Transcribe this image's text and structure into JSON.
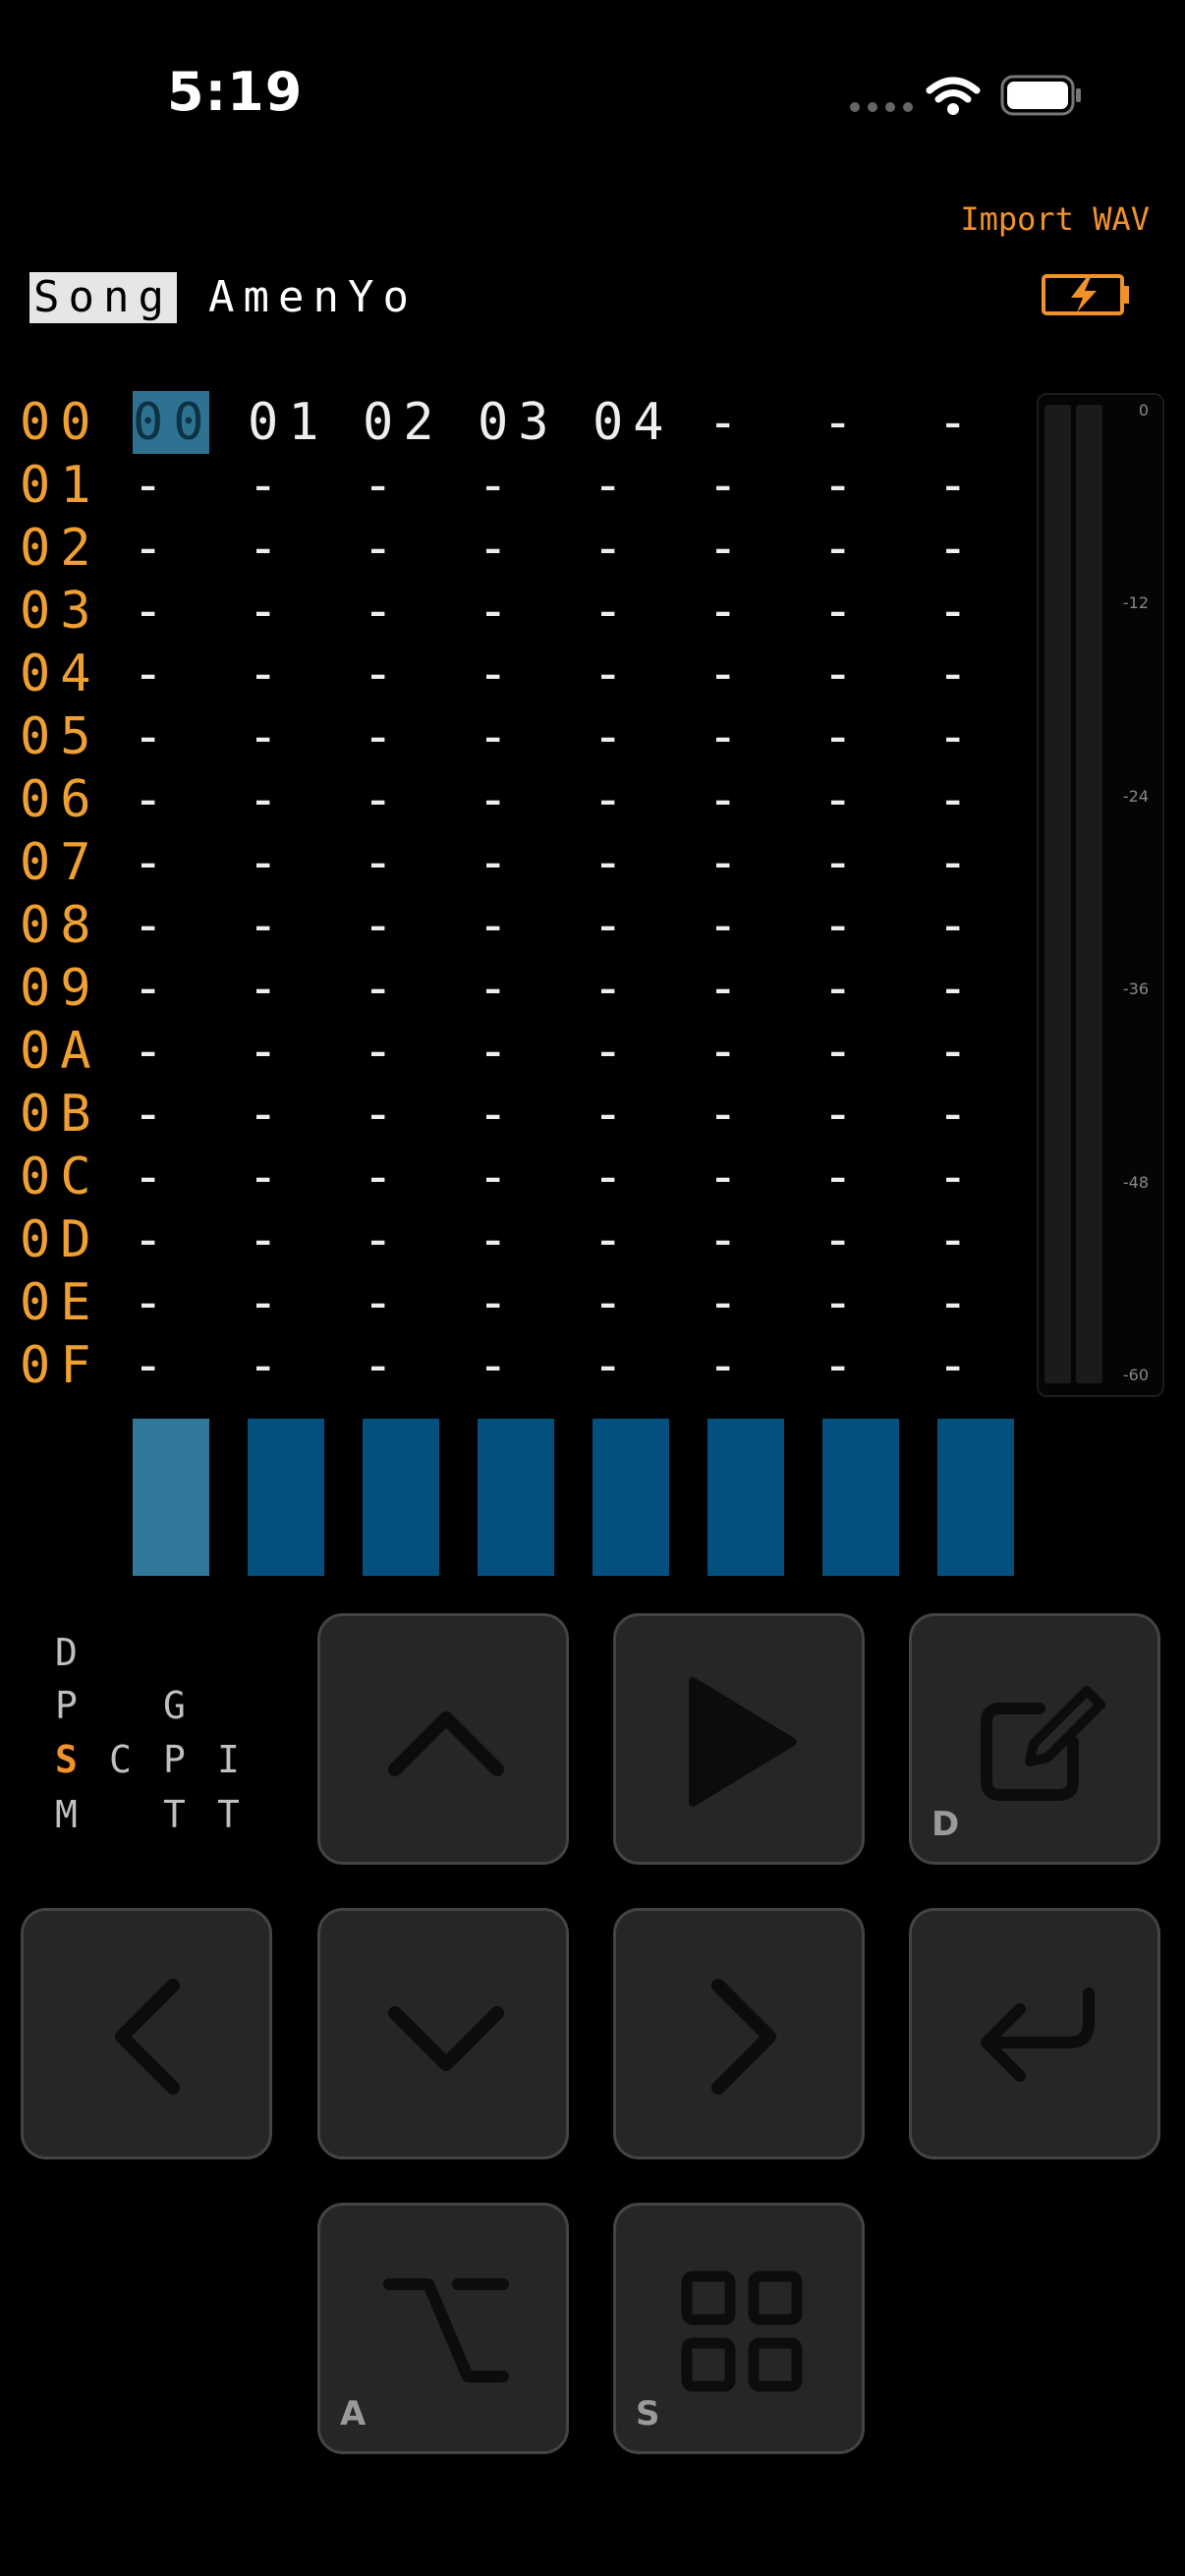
{
  "status": {
    "time": "5:19"
  },
  "header": {
    "import_label": "Import WAV",
    "mode_label": "Song",
    "song_name": "AmenYo"
  },
  "grid": {
    "rows": [
      {
        "n": "00",
        "cells": [
          "00",
          "01",
          "02",
          "03",
          "04",
          "--",
          "--",
          "--"
        ]
      },
      {
        "n": "01",
        "cells": [
          "--",
          "--",
          "--",
          "--",
          "--",
          "--",
          "--",
          "--"
        ]
      },
      {
        "n": "02",
        "cells": [
          "--",
          "--",
          "--",
          "--",
          "--",
          "--",
          "--",
          "--"
        ]
      },
      {
        "n": "03",
        "cells": [
          "--",
          "--",
          "--",
          "--",
          "--",
          "--",
          "--",
          "--"
        ]
      },
      {
        "n": "04",
        "cells": [
          "--",
          "--",
          "--",
          "--",
          "--",
          "--",
          "--",
          "--"
        ]
      },
      {
        "n": "05",
        "cells": [
          "--",
          "--",
          "--",
          "--",
          "--",
          "--",
          "--",
          "--"
        ]
      },
      {
        "n": "06",
        "cells": [
          "--",
          "--",
          "--",
          "--",
          "--",
          "--",
          "--",
          "--"
        ]
      },
      {
        "n": "07",
        "cells": [
          "--",
          "--",
          "--",
          "--",
          "--",
          "--",
          "--",
          "--"
        ]
      },
      {
        "n": "08",
        "cells": [
          "--",
          "--",
          "--",
          "--",
          "--",
          "--",
          "--",
          "--"
        ]
      },
      {
        "n": "09",
        "cells": [
          "--",
          "--",
          "--",
          "--",
          "--",
          "--",
          "--",
          "--"
        ]
      },
      {
        "n": "0A",
        "cells": [
          "--",
          "--",
          "--",
          "--",
          "--",
          "--",
          "--",
          "--"
        ]
      },
      {
        "n": "0B",
        "cells": [
          "--",
          "--",
          "--",
          "--",
          "--",
          "--",
          "--",
          "--"
        ]
      },
      {
        "n": "0C",
        "cells": [
          "--",
          "--",
          "--",
          "--",
          "--",
          "--",
          "--",
          "--"
        ]
      },
      {
        "n": "0D",
        "cells": [
          "--",
          "--",
          "--",
          "--",
          "--",
          "--",
          "--",
          "--"
        ]
      },
      {
        "n": "0E",
        "cells": [
          "--",
          "--",
          "--",
          "--",
          "--",
          "--",
          "--",
          "--"
        ]
      },
      {
        "n": "0F",
        "cells": [
          "--",
          "--",
          "--",
          "--",
          "--",
          "--",
          "--",
          "--"
        ]
      }
    ],
    "selected_cell": "00"
  },
  "meter": {
    "ticks": [
      "0",
      "-12",
      "-24",
      "-36",
      "-48",
      "-60"
    ]
  },
  "modes": {
    "d": "D",
    "p": "P",
    "g": "G",
    "s": "S",
    "c": "C",
    "p2": "P",
    "i": "I",
    "m": "M",
    "t": "T",
    "t2": "T"
  },
  "keys": {
    "edit_label": "D",
    "option_label": "A",
    "grid_label": "S"
  },
  "colors": {
    "accent": "#f0922a",
    "channel": "#03507e",
    "channel_active": "#31789a"
  }
}
